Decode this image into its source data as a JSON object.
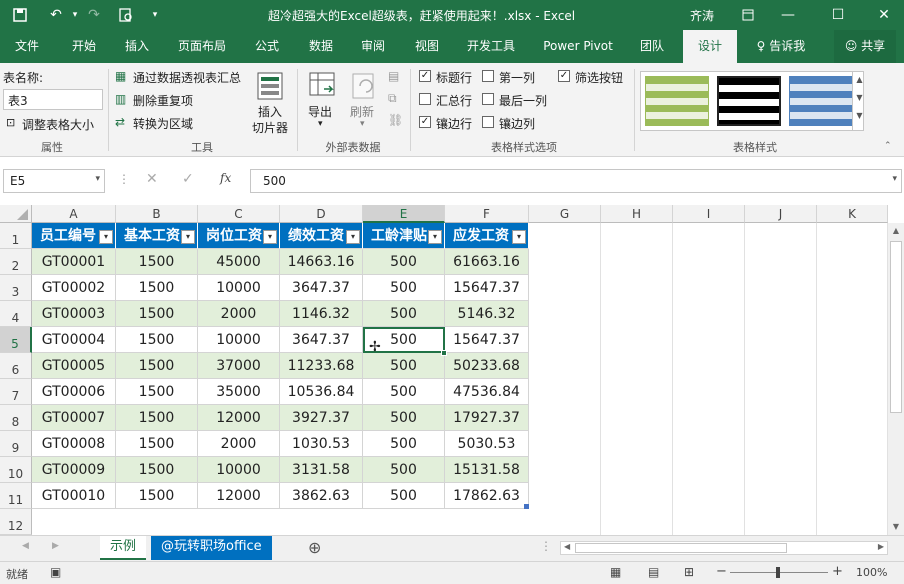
{
  "window": {
    "title": "超冷超强大的Excel超级表，赶紧使用起来！.xlsx  -  Excel",
    "user": "齐涛"
  },
  "ribbon_tabs": [
    "文件",
    "开始",
    "插入",
    "页面布局",
    "公式",
    "数据",
    "审阅",
    "视图",
    "开发工具",
    "Power Pivot",
    "团队",
    "设计",
    "告诉我",
    "共享"
  ],
  "ribbon": {
    "table_name_label": "表名称:",
    "table_name_value": "表3",
    "resize_label": "调整表格大小",
    "group_properties": "属性",
    "pivot_label": "通过数据透视表汇总",
    "remove_dup_label": "删除重复项",
    "convert_label": "转换为区域",
    "slicer_label": "插入\n切片器",
    "group_tools": "工具",
    "export_label": "导出",
    "refresh_label": "刷新",
    "group_external": "外部表数据",
    "opt_header_row": "标题行",
    "opt_first_col": "第一列",
    "opt_filter_btn": "筛选按钮",
    "opt_total_row": "汇总行",
    "opt_last_col": "最后一列",
    "opt_banded_rows": "镶边行",
    "opt_banded_cols": "镶边列",
    "group_style_options": "表格样式选项",
    "group_table_styles": "表格样式"
  },
  "formula_bar": {
    "name_box": "E5",
    "formula": "500"
  },
  "columns": [
    "A",
    "B",
    "C",
    "D",
    "E",
    "F",
    "G",
    "H",
    "I",
    "J",
    "K"
  ],
  "rows": [
    "1",
    "2",
    "3",
    "4",
    "5",
    "6",
    "7",
    "8",
    "9",
    "10",
    "11",
    "12"
  ],
  "table": {
    "headers": [
      "员工编号",
      "基本工资",
      "岗位工资",
      "绩效工资",
      "工龄津贴",
      "应发工资"
    ],
    "data": [
      [
        "GT00001",
        "1500",
        "45000",
        "14663.16",
        "500",
        "61663.16"
      ],
      [
        "GT00002",
        "1500",
        "10000",
        "3647.37",
        "500",
        "15647.37"
      ],
      [
        "GT00003",
        "1500",
        "2000",
        "1146.32",
        "500",
        "5146.32"
      ],
      [
        "GT00004",
        "1500",
        "10000",
        "3647.37",
        "500",
        "15647.37"
      ],
      [
        "GT00005",
        "1500",
        "37000",
        "11233.68",
        "500",
        "50233.68"
      ],
      [
        "GT00006",
        "1500",
        "35000",
        "10536.84",
        "500",
        "47536.84"
      ],
      [
        "GT00007",
        "1500",
        "12000",
        "3927.37",
        "500",
        "17927.37"
      ],
      [
        "GT00008",
        "1500",
        "2000",
        "1030.53",
        "500",
        "5030.53"
      ],
      [
        "GT00009",
        "1500",
        "10000",
        "3131.58",
        "500",
        "15131.58"
      ],
      [
        "GT00010",
        "1500",
        "12000",
        "3862.63",
        "500",
        "17862.63"
      ]
    ]
  },
  "sheets": [
    "示例",
    "@玩转职场office"
  ],
  "status": {
    "ready": "就绪",
    "zoom": "100%"
  },
  "colors": {
    "accent": "#217346",
    "table_header": "#0070c0",
    "band": "#e2efda"
  }
}
